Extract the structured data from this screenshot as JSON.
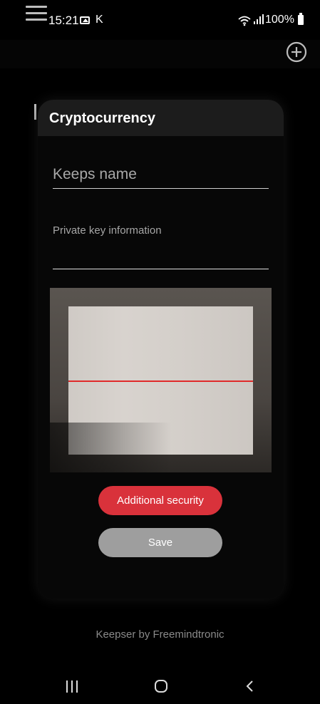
{
  "status_bar": {
    "time": "15:21",
    "carrier_letter": "K",
    "battery": "100%",
    "icons": [
      "gallery-icon",
      "wifi-icon",
      "signal-icon",
      "battery-icon"
    ]
  },
  "app_bar": {
    "icons": [
      "menu-icon",
      "add-circle-icon"
    ]
  },
  "dialog": {
    "title": "Cryptocurrency",
    "name_field": {
      "placeholder": "Keeps name",
      "value": ""
    },
    "private_key_field": {
      "label": "Private key information",
      "value": ""
    },
    "scanner": {
      "scan_line_color": "#e02a2a"
    },
    "buttons": {
      "additional_security": "Additional security",
      "save": "Save"
    }
  },
  "footer": {
    "text": "Keepser by Freemindtronic"
  },
  "nav_bar": {
    "icons": [
      "recents-icon",
      "home-icon",
      "back-icon"
    ]
  },
  "colors": {
    "accent": "#d9323b",
    "save_button": "#9e9e9e",
    "background": "#000000"
  }
}
